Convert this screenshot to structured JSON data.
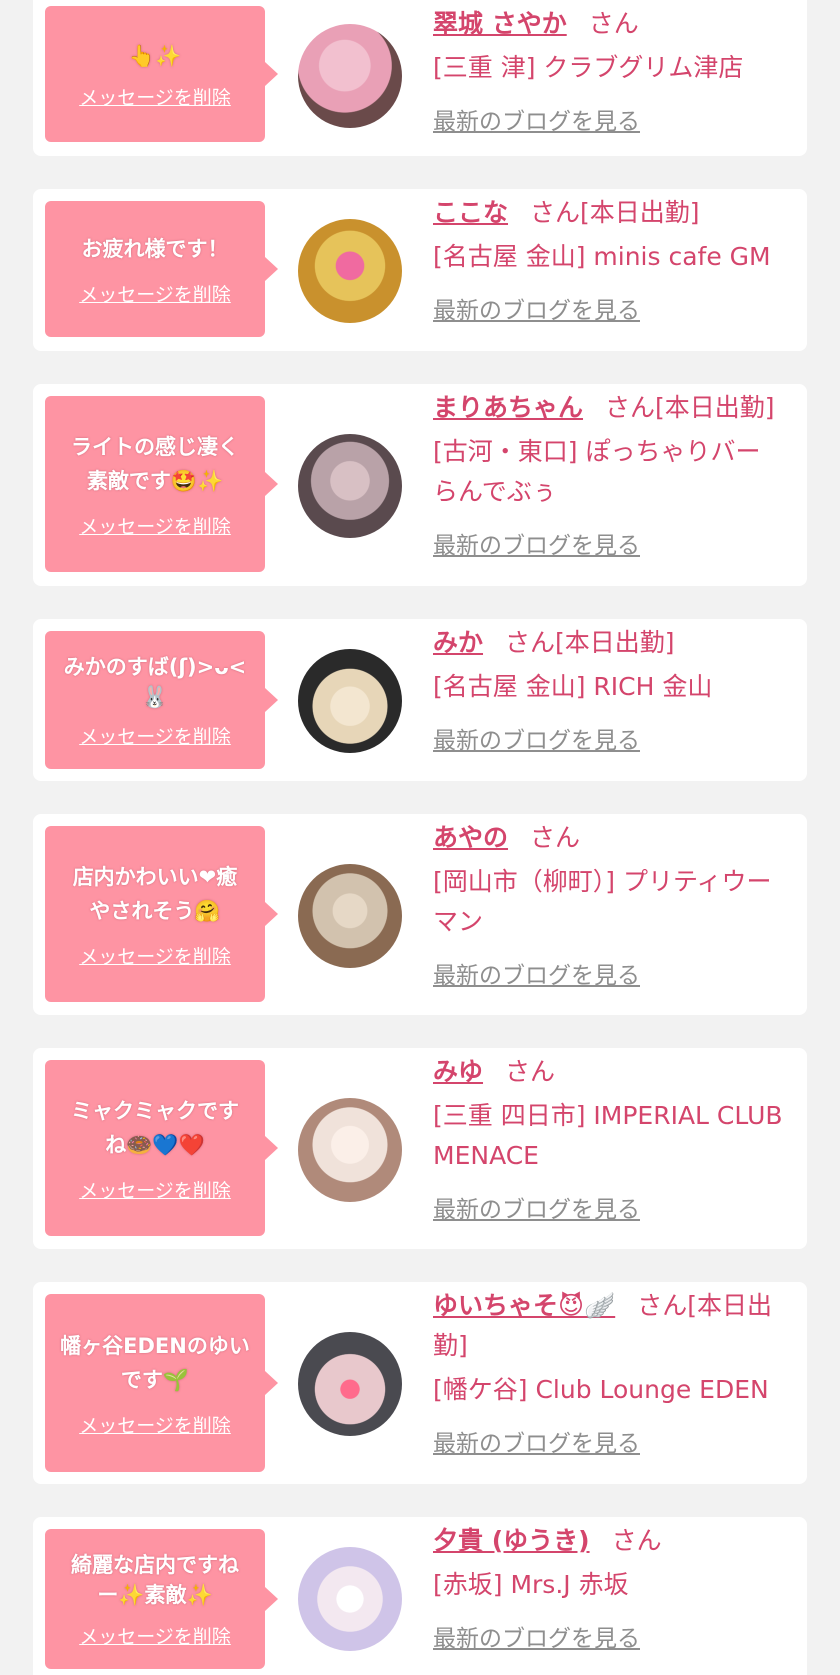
{
  "items": [
    {
      "message": [
        "👆✨"
      ],
      "delete_label": "メッセージを削除",
      "name": "翠城 さやか",
      "suffix": "さん",
      "shop": "[三重 津] クラブグリム津店",
      "blog_label": "最新のブログを見る",
      "avatar_colors": [
        "#e9a0b6",
        "#6a4a4a"
      ]
    },
    {
      "message": [
        "お疲れ様です！"
      ],
      "delete_label": "メッセージを削除",
      "name": "ここな",
      "suffix": "さん[本日出勤]",
      "shop": "[名古屋 金山] minis cafe GM",
      "blog_label": "最新のブログを見る",
      "avatar_colors": [
        "#c9912d",
        "#e6c35a"
      ]
    },
    {
      "message": [
        "ライトの感じ凄く",
        "素敵です🤩✨"
      ],
      "delete_label": "メッセージを削除",
      "name": "まりあちゃん",
      "suffix": "さん[本日出勤]",
      "shop": "[古河・東口] ぽっちゃりバー らんでぶぅ",
      "blog_label": "最新のブログを見る",
      "avatar_colors": [
        "#5a4a4e",
        "#b9a2a8"
      ]
    },
    {
      "message": [
        "みかのすば(ʃ)>ᴗ<",
        "🐰"
      ],
      "delete_label": "メッセージを削除",
      "name": "みか",
      "suffix": "さん[本日出勤]",
      "shop": "[名古屋 金山] RICH 金山",
      "blog_label": "最新のブログを見る",
      "avatar_colors": [
        "#2a2a2a",
        "#e7d6b8"
      ]
    },
    {
      "message": [
        "店内かわいい❤癒",
        "やされそう🤗"
      ],
      "delete_label": "メッセージを削除",
      "name": "あやの",
      "suffix": "さん",
      "shop": "[岡山市（柳町）] プリティウーマン",
      "blog_label": "最新のブログを見る",
      "avatar_colors": [
        "#8a6a52",
        "#d2c2ae"
      ]
    },
    {
      "message": [
        "ミャクミャクです",
        "ね🍩💙❤️"
      ],
      "delete_label": "メッセージを削除",
      "name": "みゆ",
      "suffix": "さん",
      "shop": "[三重 四日市] IMPERIAL CLUB MENACE",
      "blog_label": "最新のブログを見る",
      "avatar_colors": [
        "#b08a7a",
        "#f0e2da"
      ]
    },
    {
      "message": [
        "幡ヶ谷EDENのゆい",
        "です🌱"
      ],
      "delete_label": "メッセージを削除",
      "name": "ゆいちゃそ😈🪽",
      "suffix": "さん[本日出勤]",
      "shop": "[幡ケ谷] Club Lounge EDEN",
      "blog_label": "最新のブログを見る",
      "avatar_colors": [
        "#4a4a50",
        "#e8c8cc"
      ]
    },
    {
      "message": [
        "綺麗な店内ですね",
        "ー✨素敵✨"
      ],
      "delete_label": "メッセージを削除",
      "name": "夕貴 (ゆうき)",
      "suffix": "さん",
      "shop": "[赤坂] Mrs.J 赤坂",
      "blog_label": "最新のブログを見る",
      "avatar_colors": [
        "#cfc4e8",
        "#f3e8f0"
      ]
    }
  ]
}
